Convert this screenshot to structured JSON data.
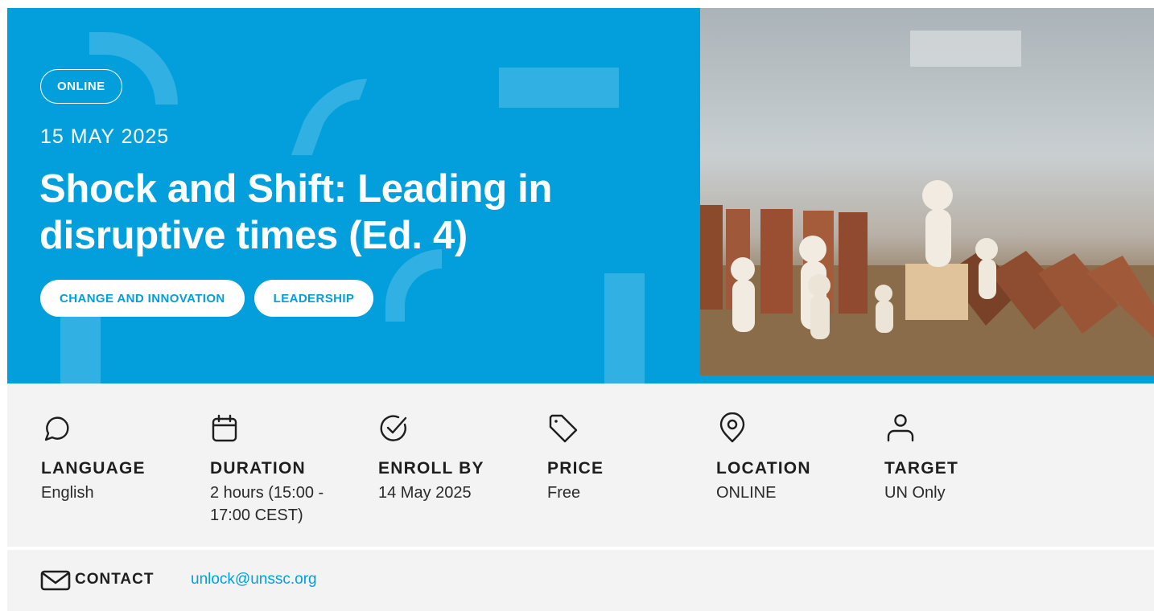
{
  "hero": {
    "badge": "ONLINE",
    "date": "15 MAY 2025",
    "title": "Shock and Shift: Leading in disruptive times (Ed. 4)",
    "tags": [
      "CHANGE AND INNOVATION",
      "LEADERSHIP"
    ],
    "background_color": "#039fdd"
  },
  "details": [
    {
      "icon": "chat-bubble-icon",
      "label": "LANGUAGE",
      "value": "English"
    },
    {
      "icon": "calendar-icon",
      "label": "DURATION",
      "value": "2 hours (15:00 - 17:00 CEST)"
    },
    {
      "icon": "check-circle-icon",
      "label": "ENROLL BY",
      "value": "14 May 2025"
    },
    {
      "icon": "price-tag-icon",
      "label": "PRICE",
      "value": "Free"
    },
    {
      "icon": "location-pin-icon",
      "label": "LOCATION",
      "value": "ONLINE"
    },
    {
      "icon": "person-icon",
      "label": "TARGET",
      "value": "UN Only"
    }
  ],
  "contact": {
    "icon": "mail-icon",
    "label": "CONTACT",
    "email": "unlock@unssc.org"
  }
}
